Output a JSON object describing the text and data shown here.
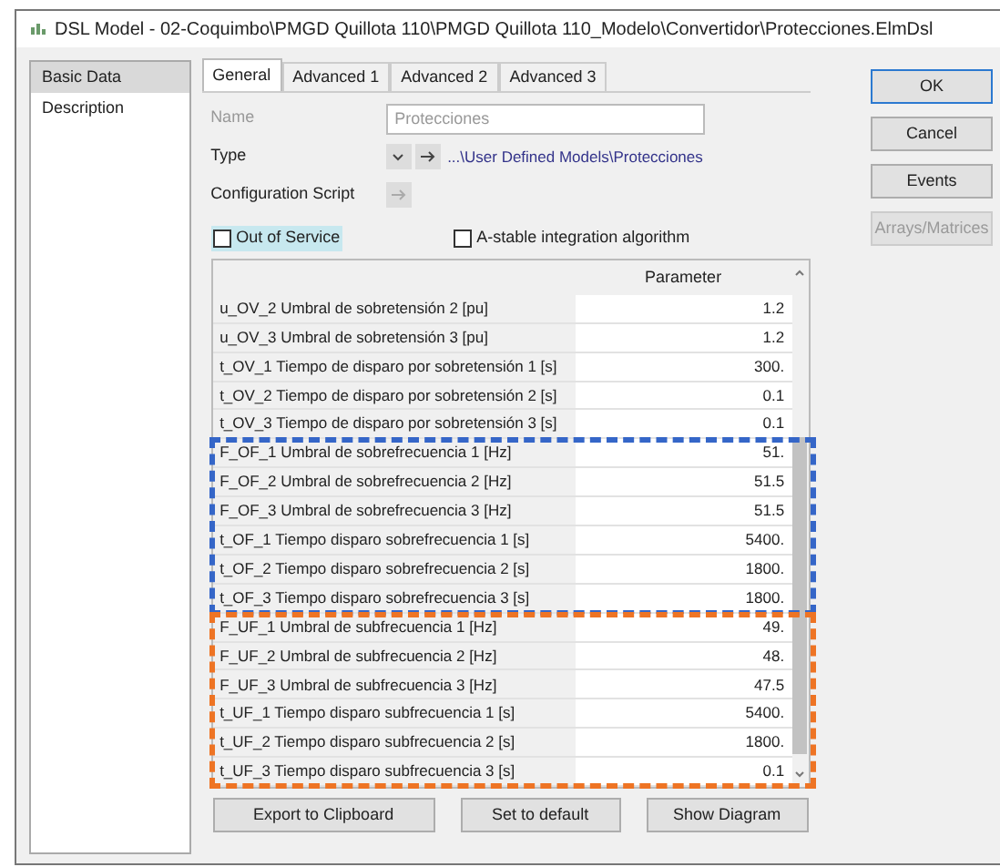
{
  "window": {
    "title": "DSL Model - 02-Coquimbo\\PMGD Quillota 110\\PMGD Quillota 110_Modelo\\Convertidor\\Protecciones.ElmDsl"
  },
  "sidebar": {
    "items": [
      {
        "label": "Basic Data",
        "selected": true
      },
      {
        "label": "Description",
        "selected": false
      }
    ]
  },
  "tabs": [
    {
      "label": "General",
      "selected": true
    },
    {
      "label": "Advanced 1",
      "selected": false
    },
    {
      "label": "Advanced 2",
      "selected": false
    },
    {
      "label": "Advanced 3",
      "selected": false
    }
  ],
  "form": {
    "name_label": "Name",
    "name_value": "Protecciones",
    "type_label": "Type",
    "type_link": "...\\User Defined Models\\Protecciones",
    "config_label": "Configuration Script"
  },
  "checkboxes": [
    {
      "label": "Out of Service",
      "checked": false,
      "highlighted": true
    },
    {
      "label": "A-stable integration algorithm",
      "checked": false,
      "highlighted": false
    }
  ],
  "table": {
    "header": "Parameter",
    "row_groups": [
      {
        "rows": [
          [
            "u_OV_2 Umbral de sobretensión 2 [pu]",
            "1.2"
          ],
          [
            "u_OV_3 Umbral de sobretensión 3 [pu]",
            "1.2"
          ],
          [
            "t_OV_1 Tiempo de disparo por sobretensión 1 [s]",
            "300."
          ],
          [
            "t_OV_2 Tiempo de disparo por sobretensión 2 [s]",
            "0.1"
          ],
          [
            "t_OV_3 Tiempo de disparo por sobretensión 3 [s]",
            "0.1"
          ]
        ]
      },
      {
        "color": "#3566c8",
        "rows": [
          [
            "F_OF_1 Umbral de sobrefrecuencia 1 [Hz]",
            "51."
          ],
          [
            "F_OF_2 Umbral de sobrefrecuencia 2 [Hz]",
            "51.5"
          ],
          [
            "F_OF_3 Umbral de sobrefrecuencia 3 [Hz]",
            "51.5"
          ],
          [
            "t_OF_1 Tiempo disparo sobrefrecuencia 1 [s]",
            "5400."
          ],
          [
            "t_OF_2 Tiempo disparo sobrefrecuencia 2 [s]",
            "1800."
          ],
          [
            "t_OF_3 Tiempo disparo sobrefrecuencia 3 [s]",
            "1800."
          ]
        ]
      },
      {
        "color": "#ee7424",
        "rows": [
          [
            "F_UF_1 Umbral de subfrecuencia 1 [Hz]",
            "49."
          ],
          [
            "F_UF_2 Umbral de subfrecuencia 2 [Hz]",
            "48."
          ],
          [
            "F_UF_3 Umbral de subfrecuencia 3 [Hz]",
            "47.5"
          ],
          [
            "t_UF_1 Tiempo disparo subfrecuencia 1 [s]",
            "5400."
          ],
          [
            "t_UF_2 Tiempo disparo subfrecuencia 2 [s]",
            "1800."
          ],
          [
            "t_UF_3 Tiempo disparo subfrecuencia 3 [s]",
            "0.1"
          ]
        ]
      }
    ]
  },
  "bottom_buttons": [
    "Export to Clipboard",
    "Set to default",
    "Show Diagram"
  ],
  "side_buttons": [
    {
      "label": "OK",
      "kind": "default"
    },
    {
      "label": "Cancel",
      "kind": "normal"
    },
    {
      "label": "Events",
      "kind": "normal"
    },
    {
      "label": "Arrays/Matrices",
      "kind": "disabled"
    }
  ]
}
